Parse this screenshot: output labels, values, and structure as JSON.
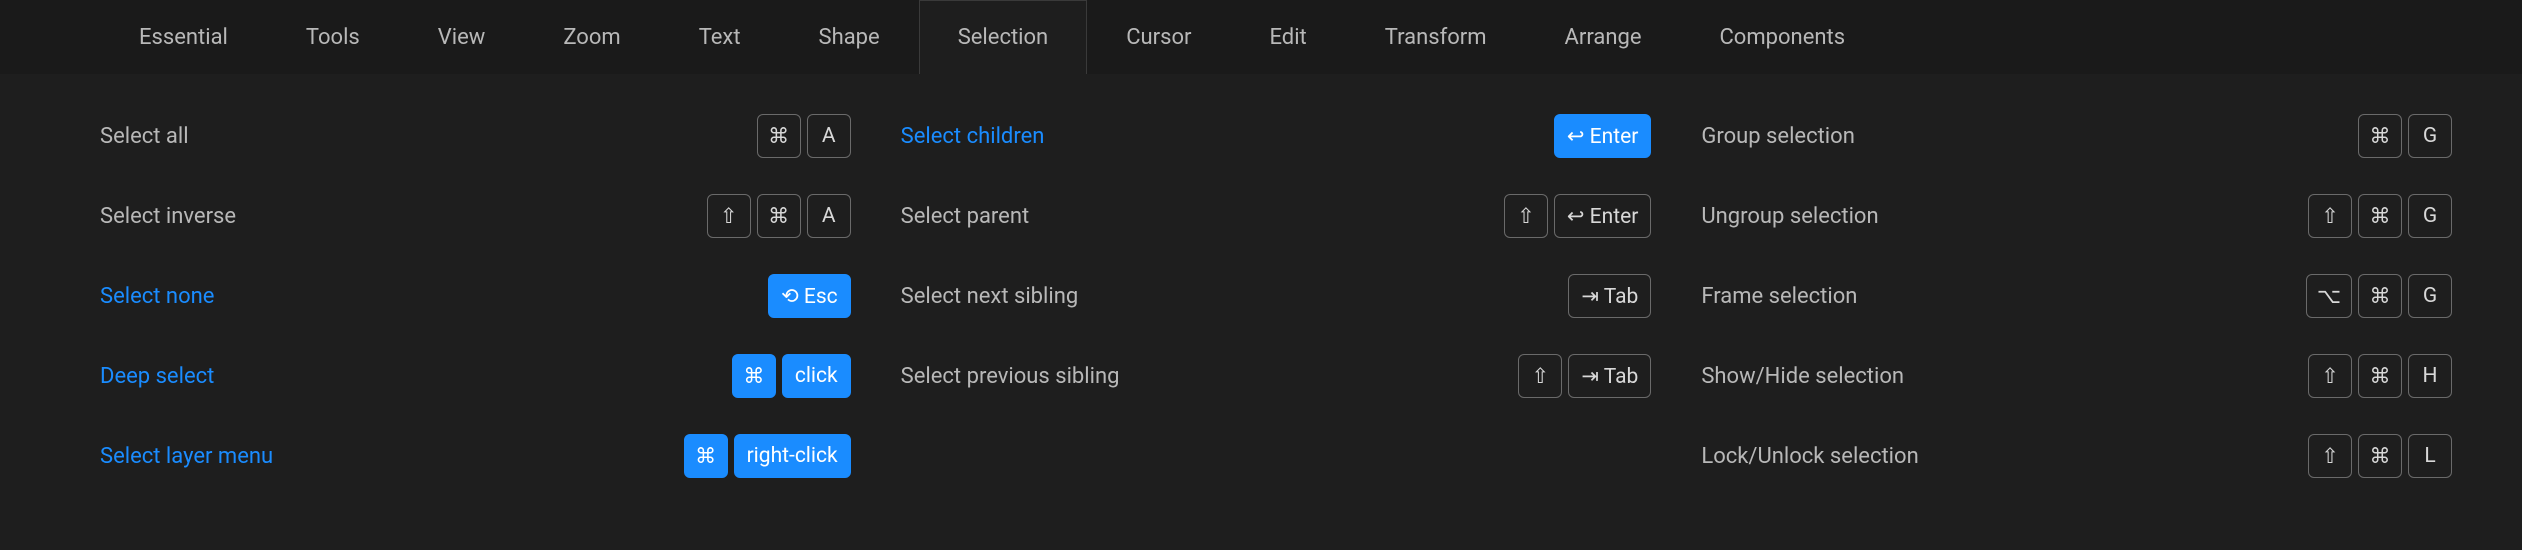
{
  "tabs": [
    {
      "label": "Essential",
      "active": false
    },
    {
      "label": "Tools",
      "active": false
    },
    {
      "label": "View",
      "active": false
    },
    {
      "label": "Zoom",
      "active": false
    },
    {
      "label": "Text",
      "active": false
    },
    {
      "label": "Shape",
      "active": false
    },
    {
      "label": "Selection",
      "active": true
    },
    {
      "label": "Cursor",
      "active": false
    },
    {
      "label": "Edit",
      "active": false
    },
    {
      "label": "Transform",
      "active": false
    },
    {
      "label": "Arrange",
      "active": false
    },
    {
      "label": "Components",
      "active": false
    }
  ],
  "columns": [
    [
      {
        "label": "Select all",
        "highlight": false,
        "keys": [
          {
            "k": "⌘"
          },
          {
            "k": "A"
          }
        ]
      },
      {
        "label": "Select inverse",
        "highlight": false,
        "keys": [
          {
            "k": "⇧"
          },
          {
            "k": "⌘"
          },
          {
            "k": "A"
          }
        ]
      },
      {
        "label": "Select none",
        "highlight": true,
        "keys": [
          {
            "k": "⟲ Esc",
            "blue": true,
            "word": true
          }
        ]
      },
      {
        "label": "Deep select",
        "highlight": true,
        "keys": [
          {
            "k": "⌘",
            "blue": true
          },
          {
            "k": "click",
            "blue": true,
            "word": true
          }
        ]
      },
      {
        "label": "Select layer menu",
        "highlight": true,
        "keys": [
          {
            "k": "⌘",
            "blue": true
          },
          {
            "k": "right-click",
            "blue": true,
            "word": true
          }
        ]
      }
    ],
    [
      {
        "label": "Select children",
        "highlight": true,
        "keys": [
          {
            "k": "↩ Enter",
            "blue": true,
            "word": true
          }
        ]
      },
      {
        "label": "Select parent",
        "highlight": false,
        "keys": [
          {
            "k": "⇧"
          },
          {
            "k": "↩ Enter",
            "word": true
          }
        ]
      },
      {
        "label": "Select next sibling",
        "highlight": false,
        "keys": [
          {
            "k": "⇥ Tab",
            "word": true
          }
        ]
      },
      {
        "label": "Select previous sibling",
        "highlight": false,
        "keys": [
          {
            "k": "⇧"
          },
          {
            "k": "⇥ Tab",
            "word": true
          }
        ]
      }
    ],
    [
      {
        "label": "Group selection",
        "highlight": false,
        "keys": [
          {
            "k": "⌘"
          },
          {
            "k": "G"
          }
        ]
      },
      {
        "label": "Ungroup selection",
        "highlight": false,
        "keys": [
          {
            "k": "⇧"
          },
          {
            "k": "⌘"
          },
          {
            "k": "G"
          }
        ]
      },
      {
        "label": "Frame selection",
        "highlight": false,
        "keys": [
          {
            "k": "⌥"
          },
          {
            "k": "⌘"
          },
          {
            "k": "G"
          }
        ]
      },
      {
        "label": "Show/Hide selection",
        "highlight": false,
        "keys": [
          {
            "k": "⇧"
          },
          {
            "k": "⌘"
          },
          {
            "k": "H"
          }
        ]
      },
      {
        "label": "Lock/Unlock selection",
        "highlight": false,
        "keys": [
          {
            "k": "⇧"
          },
          {
            "k": "⌘"
          },
          {
            "k": "L"
          }
        ]
      }
    ]
  ]
}
